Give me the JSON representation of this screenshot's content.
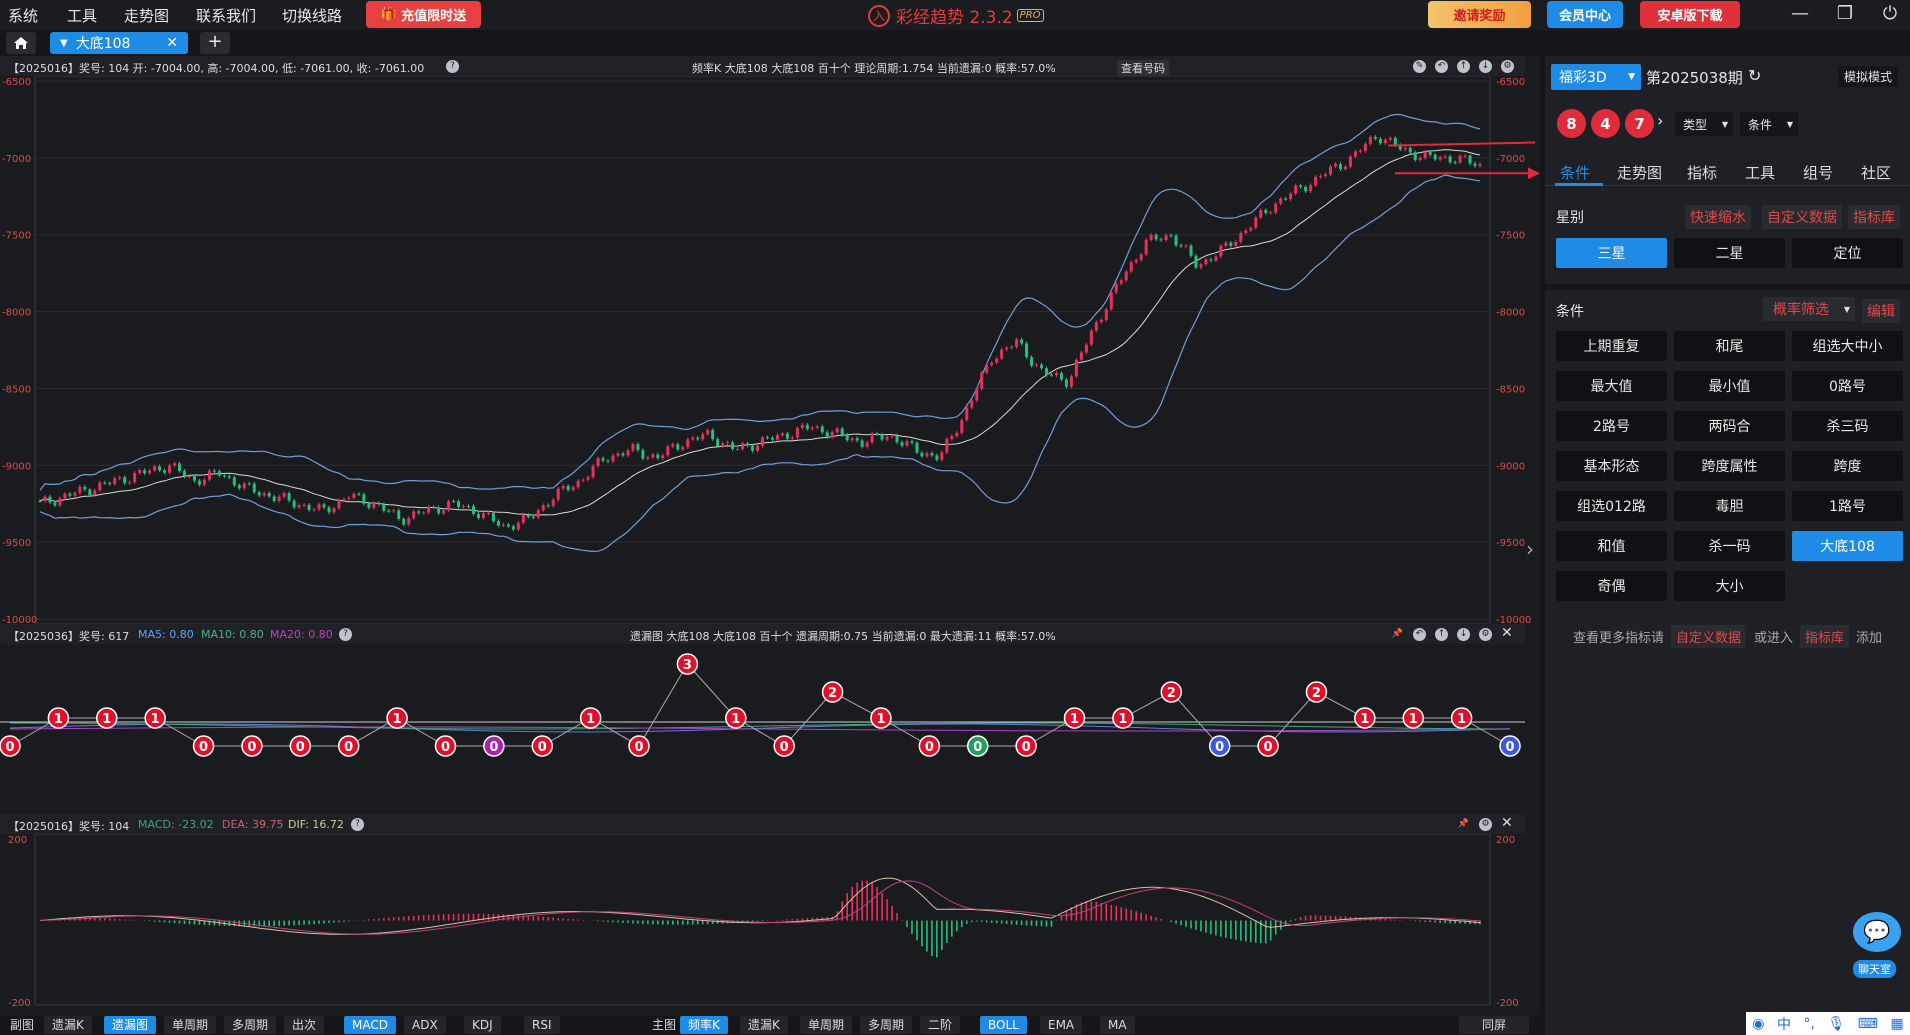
{
  "menu": [
    "系统",
    "工具",
    "走势图",
    "联系我们",
    "切换线路"
  ],
  "promo_recharge": "充值限时送",
  "app": {
    "name": "彩经趋势 2.3.2",
    "badge": "PRO"
  },
  "top_right": {
    "invite": "邀请奖励",
    "member": "会员中心",
    "android": "安卓版下载"
  },
  "tab": {
    "active": "大底108"
  },
  "panel1": {
    "head_left": "【2025016】奖号: 104  开: -7004.00, 高: -7004.00, 低: -7061.00, 收: -7061.00",
    "head_mid": "频率K  大底108  大底108  百十个  理论周期:1.754  当前遗漏:0  概率:57.0%",
    "view_btn": "查看号码",
    "y_ticks": [
      "-6500",
      "-7000",
      "-7500",
      "-8000",
      "-8500",
      "-9000",
      "-9500",
      "-10000"
    ]
  },
  "panel2": {
    "head_left": "【2025036】奖号: 617",
    "ma5": "MA5: 0.80",
    "ma10": "MA10: 0.80",
    "ma20": "MA20: 0.80",
    "head_mid": "遗漏图  大底108  大底108  百十个  遗漏周期:0.75  当前遗漏:0  最大遗漏:11  概率:57.0%"
  },
  "panel3": {
    "head_left": "【2025016】奖号: 104",
    "macd": "MACD: -23.02",
    "dea": "DEA: 39.75",
    "dif": "DIF: 16.72",
    "y_ticks": [
      "200",
      "-200"
    ]
  },
  "sidebar": {
    "lottery": "福彩3D",
    "period": "第2025038期",
    "sim_mode": "模拟模式",
    "balls": [
      "8",
      "4",
      "7"
    ],
    "sel_type": "类型",
    "sel_cond": "条件",
    "nav": [
      "条件",
      "走势图",
      "指标",
      "工具",
      "组号",
      "社区"
    ],
    "star_label": "星别",
    "quick_zoom": "快速缩水",
    "custom_data": "自定义数据",
    "index_lib": "指标库",
    "stars": [
      "三星",
      "二星",
      "定位"
    ],
    "cond_label": "条件",
    "prob_filter": "概率筛选",
    "edit": "编辑",
    "conditions": [
      "上期重复",
      "和尾",
      "组选大中小",
      "最大值",
      "最小值",
      "0路号",
      "2路号",
      "两码合",
      "杀三码",
      "基本形态",
      "跨度属性",
      "跨度",
      "组选012路",
      "毒胆",
      "1路号",
      "和值",
      "杀一码",
      "大底108",
      "奇偶",
      "大小"
    ],
    "more_text": "查看更多指标请",
    "more_custom": "自定义数据",
    "or_enter": "或进入",
    "more_lib": "指标库",
    "add": "添加",
    "chat": "聊天室"
  },
  "bottom_left": [
    "副图",
    "遗漏K",
    "遗漏图",
    "单周期",
    "多周期",
    "出次",
    "MACD",
    "ADX",
    "KDJ",
    "RSI"
  ],
  "bottom_right": [
    "主图",
    "频率K",
    "遗漏K",
    "单周期",
    "多周期",
    "二阶",
    "BOLL",
    "EMA",
    "MA"
  ],
  "sync": "同屏",
  "chart_data": [
    {
      "type": "candlestick",
      "ylim": [
        -10000,
        -6500
      ],
      "y_ticks": [
        -6500,
        -7000,
        -7500,
        -8000,
        -8500,
        -9000,
        -9500,
        -10000
      ],
      "close_series": [
        -9250,
        -9200,
        -9150,
        -9100,
        -9050,
        -9000,
        -9100,
        -9050,
        -9150,
        -9200,
        -9250,
        -9300,
        -9200,
        -9250,
        -9350,
        -9300,
        -9250,
        -9300,
        -9400,
        -9350,
        -9200,
        -9100,
        -8950,
        -8900,
        -8950,
        -8850,
        -8800,
        -8900,
        -8850,
        -8800,
        -8750,
        -8800,
        -8850,
        -8800,
        -8900,
        -8950,
        -8650,
        -8300,
        -8200,
        -8400,
        -8450,
        -8100,
        -7800,
        -7550,
        -7500,
        -7700,
        -7600,
        -7450,
        -7300,
        -7200,
        -7100,
        -7000,
        -6850,
        -6950,
        -7000,
        -7000,
        -7050
      ],
      "bands": "BOLL"
    },
    {
      "type": "line",
      "title": "遗漏图",
      "values": [
        0,
        1,
        1,
        1,
        0,
        0,
        0,
        0,
        1,
        0,
        0,
        0,
        1,
        0,
        3,
        1,
        0,
        2,
        1,
        0,
        0,
        0,
        1,
        1,
        2,
        0,
        0,
        2,
        1,
        1,
        1,
        0
      ],
      "ylim": [
        0,
        3
      ]
    },
    {
      "type": "bar",
      "title": "MACD",
      "ylim": [
        -200,
        200
      ],
      "y_ticks": [
        200,
        -200
      ]
    }
  ]
}
